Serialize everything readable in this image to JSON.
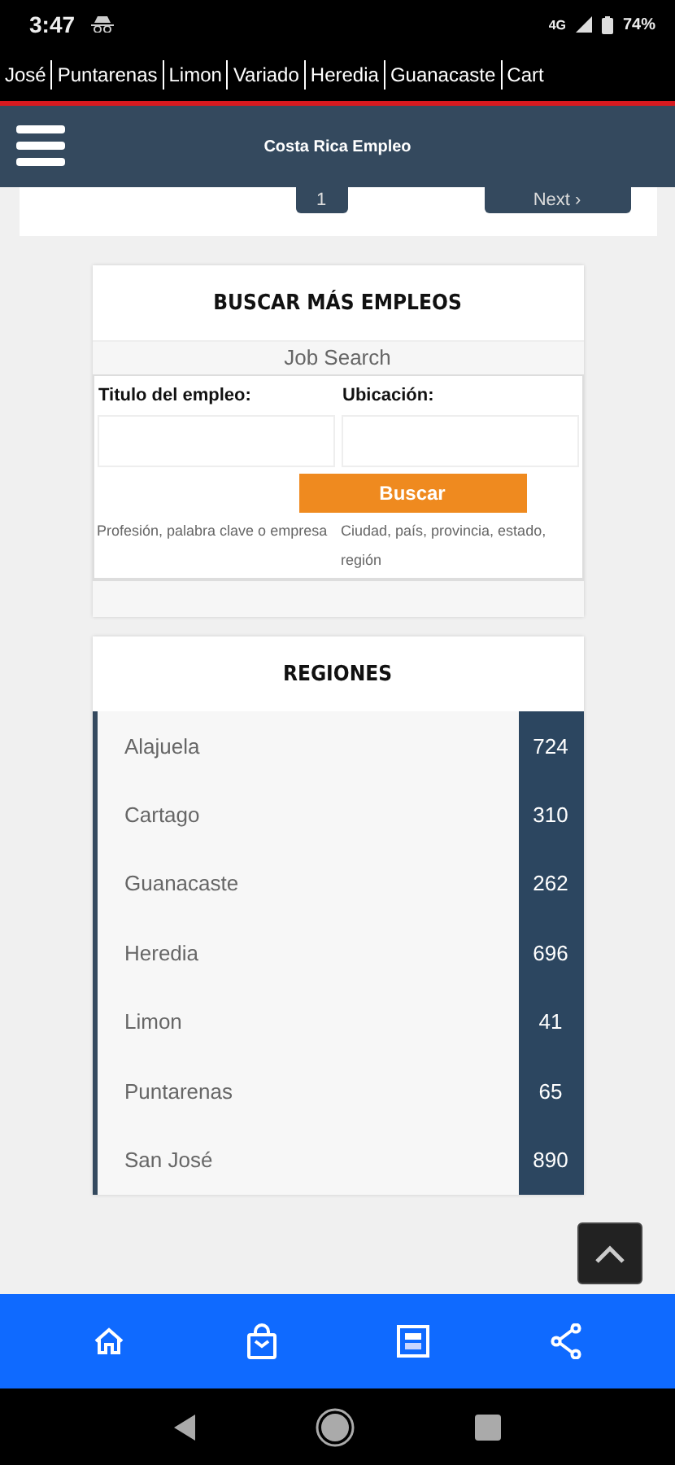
{
  "status_bar": {
    "time": "3:47",
    "network": "4G",
    "battery": "74%"
  },
  "ticker": [
    "José",
    "Puntarenas",
    "Limon",
    "Variado",
    "Heredia",
    "Guanacaste",
    "Cart"
  ],
  "header": {
    "title": "Costa Rica Empleo"
  },
  "pagination": {
    "page": "1",
    "next": "Next ›"
  },
  "search": {
    "title": "BUSCAR MÁS EMPLEOS",
    "subtitle": "Job Search",
    "fields": [
      {
        "label": "Titulo del empleo:",
        "hint": "Profesión, palabra clave o empresa"
      },
      {
        "label": "Ubicación:",
        "hint": "Ciudad, país, provincia, estado, región"
      }
    ],
    "button": "Buscar"
  },
  "regions": {
    "title": "REGIONES",
    "items": [
      {
        "name": "Alajuela",
        "count": "724"
      },
      {
        "name": "Cartago",
        "count": "310"
      },
      {
        "name": "Guanacaste",
        "count": "262"
      },
      {
        "name": "Heredia",
        "count": "696"
      },
      {
        "name": "Limon",
        "count": "41"
      },
      {
        "name": "Puntarenas",
        "count": "65"
      },
      {
        "name": "San José",
        "count": "890"
      }
    ]
  },
  "bottom_nav": [
    {
      "kind": "home"
    },
    {
      "kind": "bag"
    },
    {
      "kind": "page"
    },
    {
      "kind": "share"
    }
  ]
}
